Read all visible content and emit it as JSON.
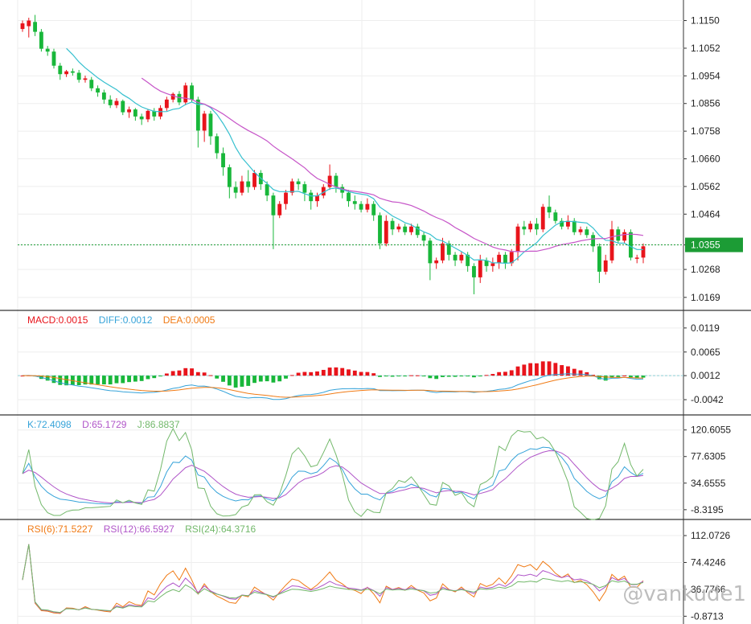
{
  "colors": {
    "up": "#e8141b",
    "down": "#18b73a",
    "ma_short": "#36c0cf",
    "ma_long": "#c655c8",
    "grid": "#eeeeee",
    "price_line": "#1c9c35",
    "price_tag": "#1c9c35",
    "orange": "#f07a14",
    "green": "#72b86a",
    "text": "#222222"
  },
  "watermark": "@vankude1",
  "legends": {
    "macd": [
      {
        "text": "MACD:0.0015",
        "color": "#e8141b"
      },
      {
        "text": "DIFF:0.0012",
        "color": "#36a3d9"
      },
      {
        "text": "DEA:0.0005",
        "color": "#f07a14"
      }
    ],
    "kdj": [
      {
        "text": "K:72.4098",
        "color": "#36a3d9"
      },
      {
        "text": "D:65.1729",
        "color": "#b055c8"
      },
      {
        "text": "J:86.8837",
        "color": "#72b86a"
      }
    ],
    "rsi": [
      {
        "text": "RSI(6):71.5227",
        "color": "#f07a14"
      },
      {
        "text": "RSI(12):66.5927",
        "color": "#b055c8"
      },
      {
        "text": "RSI(24):64.3716",
        "color": "#72b86a"
      }
    ]
  },
  "chart_data": [
    {
      "type": "candlestick",
      "panel": "price",
      "current_price": "1.0355",
      "yticks": [
        "1.1150",
        "1.1052",
        "1.0954",
        "1.0856",
        "1.0758",
        "1.0660",
        "1.0562",
        "1.0464",
        "1.0355",
        "1.0268",
        "1.0169"
      ],
      "ylim": [
        1.014,
        1.12
      ],
      "candles": [
        [
          1.112,
          1.114,
          1.111,
          1.115
        ],
        [
          1.113,
          1.115,
          1.109,
          1.116
        ],
        [
          1.1145,
          1.111,
          1.1095,
          1.117
        ],
        [
          1.111,
          1.105,
          1.104,
          1.112
        ],
        [
          1.105,
          1.104,
          1.1025,
          1.106
        ],
        [
          1.104,
          1.099,
          1.098,
          1.105
        ],
        [
          1.099,
          1.096,
          1.094,
          1.1
        ],
        [
          1.096,
          1.097,
          1.095,
          1.0975
        ],
        [
          1.097,
          1.0965,
          1.0955,
          1.098
        ],
        [
          1.0965,
          1.094,
          1.093,
          1.0975
        ],
        [
          1.094,
          1.0945,
          1.093,
          1.0955
        ],
        [
          1.094,
          1.091,
          1.09,
          1.095
        ],
        [
          1.091,
          1.0895,
          1.088,
          1.092
        ],
        [
          1.0895,
          1.087,
          1.0855,
          1.0905
        ],
        [
          1.087,
          1.085,
          1.084,
          1.0885
        ],
        [
          1.085,
          1.0865,
          1.084,
          1.0875
        ],
        [
          1.0865,
          1.0825,
          1.0815,
          1.087
        ],
        [
          1.0825,
          1.0835,
          1.0805,
          1.0845
        ],
        [
          1.0835,
          1.081,
          1.0795,
          1.084
        ],
        [
          1.081,
          1.08,
          1.078,
          1.082
        ],
        [
          1.08,
          1.083,
          1.079,
          1.0835
        ],
        [
          1.083,
          1.081,
          1.0795,
          1.084
        ],
        [
          1.081,
          1.084,
          1.08,
          1.085
        ],
        [
          1.084,
          1.087,
          1.083,
          1.088
        ],
        [
          1.087,
          1.089,
          1.086,
          1.0895
        ],
        [
          1.089,
          1.086,
          1.085,
          1.09
        ],
        [
          1.086,
          1.092,
          1.085,
          1.093
        ],
        [
          1.092,
          1.087,
          1.086,
          1.093
        ],
        [
          1.087,
          1.076,
          1.07,
          1.088
        ],
        [
          1.076,
          1.082,
          1.072,
          1.083
        ],
        [
          1.082,
          1.074,
          1.071,
          1.083
        ],
        [
          1.074,
          1.068,
          1.066,
          1.075
        ],
        [
          1.068,
          1.063,
          1.06,
          1.07
        ],
        [
          1.063,
          1.056,
          1.052,
          1.064
        ],
        [
          1.056,
          1.054,
          1.052,
          1.058
        ],
        [
          1.054,
          1.058,
          1.053,
          1.06
        ],
        [
          1.058,
          1.056,
          1.054,
          1.062
        ],
        [
          1.056,
          1.061,
          1.055,
          1.062
        ],
        [
          1.061,
          1.057,
          1.055,
          1.062
        ],
        [
          1.057,
          1.053,
          1.051,
          1.058
        ],
        [
          1.053,
          1.046,
          1.034,
          1.054
        ],
        [
          1.046,
          1.05,
          1.045,
          1.051
        ],
        [
          1.05,
          1.054,
          1.048,
          1.055
        ],
        [
          1.054,
          1.058,
          1.053,
          1.059
        ],
        [
          1.058,
          1.057,
          1.055,
          1.059
        ],
        [
          1.057,
          1.054,
          1.051,
          1.058
        ],
        [
          1.054,
          1.051,
          1.048,
          1.055
        ],
        [
          1.051,
          1.053,
          1.049,
          1.054
        ],
        [
          1.053,
          1.056,
          1.052,
          1.057
        ],
        [
          1.056,
          1.06,
          1.055,
          1.064
        ],
        [
          1.06,
          1.056,
          1.054,
          1.061
        ],
        [
          1.056,
          1.054,
          1.052,
          1.057
        ],
        [
          1.054,
          1.051,
          1.049,
          1.055
        ],
        [
          1.051,
          1.05,
          1.048,
          1.053
        ],
        [
          1.05,
          1.048,
          1.047,
          1.051
        ],
        [
          1.048,
          1.05,
          1.047,
          1.052
        ],
        [
          1.05,
          1.046,
          1.044,
          1.051
        ],
        [
          1.046,
          1.036,
          1.034,
          1.047
        ],
        [
          1.036,
          1.044,
          1.035,
          1.046
        ],
        [
          1.044,
          1.041,
          1.039,
          1.045
        ],
        [
          1.041,
          1.042,
          1.04,
          1.043
        ],
        [
          1.042,
          1.04,
          1.039,
          1.043
        ],
        [
          1.04,
          1.042,
          1.039,
          1.043
        ],
        [
          1.042,
          1.039,
          1.038,
          1.043
        ],
        [
          1.039,
          1.037,
          1.035,
          1.04
        ],
        [
          1.037,
          1.029,
          1.023,
          1.038
        ],
        [
          1.029,
          1.03,
          1.027,
          1.031
        ],
        [
          1.03,
          1.036,
          1.029,
          1.038
        ],
        [
          1.036,
          1.032,
          1.03,
          1.037
        ],
        [
          1.032,
          1.03,
          1.028,
          1.033
        ],
        [
          1.03,
          1.032,
          1.029,
          1.033
        ],
        [
          1.032,
          1.028,
          1.026,
          1.033
        ],
        [
          1.028,
          1.024,
          1.018,
          1.029
        ],
        [
          1.024,
          1.03,
          1.022,
          1.032
        ],
        [
          1.03,
          1.028,
          1.026,
          1.031
        ],
        [
          1.028,
          1.029,
          1.026,
          1.031
        ],
        [
          1.029,
          1.032,
          1.027,
          1.033
        ],
        [
          1.032,
          1.029,
          1.027,
          1.033
        ],
        [
          1.029,
          1.033,
          1.028,
          1.034
        ],
        [
          1.033,
          1.042,
          1.03,
          1.043
        ],
        [
          1.042,
          1.041,
          1.039,
          1.044
        ],
        [
          1.041,
          1.043,
          1.04,
          1.044
        ],
        [
          1.043,
          1.041,
          1.039,
          1.045
        ],
        [
          1.041,
          1.049,
          1.04,
          1.05
        ],
        [
          1.049,
          1.047,
          1.045,
          1.053
        ],
        [
          1.047,
          1.044,
          1.043,
          1.048
        ],
        [
          1.044,
          1.042,
          1.041,
          1.045
        ],
        [
          1.042,
          1.044,
          1.041,
          1.046
        ],
        [
          1.044,
          1.04,
          1.039,
          1.045
        ],
        [
          1.04,
          1.041,
          1.039,
          1.042
        ],
        [
          1.041,
          1.039,
          1.038,
          1.042
        ],
        [
          1.039,
          1.035,
          1.033,
          1.04
        ],
        [
          1.035,
          1.026,
          1.022,
          1.036
        ],
        [
          1.026,
          1.03,
          1.025,
          1.032
        ],
        [
          1.03,
          1.041,
          1.029,
          1.044
        ],
        [
          1.041,
          1.037,
          1.036,
          1.042
        ],
        [
          1.037,
          1.04,
          1.036,
          1.041
        ],
        [
          1.04,
          1.031,
          1.03,
          1.041
        ],
        [
          1.031,
          1.031,
          1.029,
          1.032
        ],
        [
          1.031,
          1.035,
          1.029,
          1.036
        ]
      ]
    },
    {
      "type": "bar+line",
      "panel": "macd",
      "yticks": [
        "0.0119",
        "0.0065",
        "0.0012",
        "-0.0042"
      ],
      "ylim": [
        -0.006,
        0.0135
      ]
    },
    {
      "type": "line",
      "panel": "kdj",
      "yticks": [
        "120.6055",
        "77.6305",
        "34.6555",
        "-8.3195"
      ],
      "ylim": [
        -15,
        128
      ]
    },
    {
      "type": "line",
      "panel": "rsi",
      "yticks": [
        "112.0726",
        "74.4246",
        "36.7766",
        "-0.8713"
      ],
      "ylim": [
        -5,
        120
      ]
    }
  ]
}
